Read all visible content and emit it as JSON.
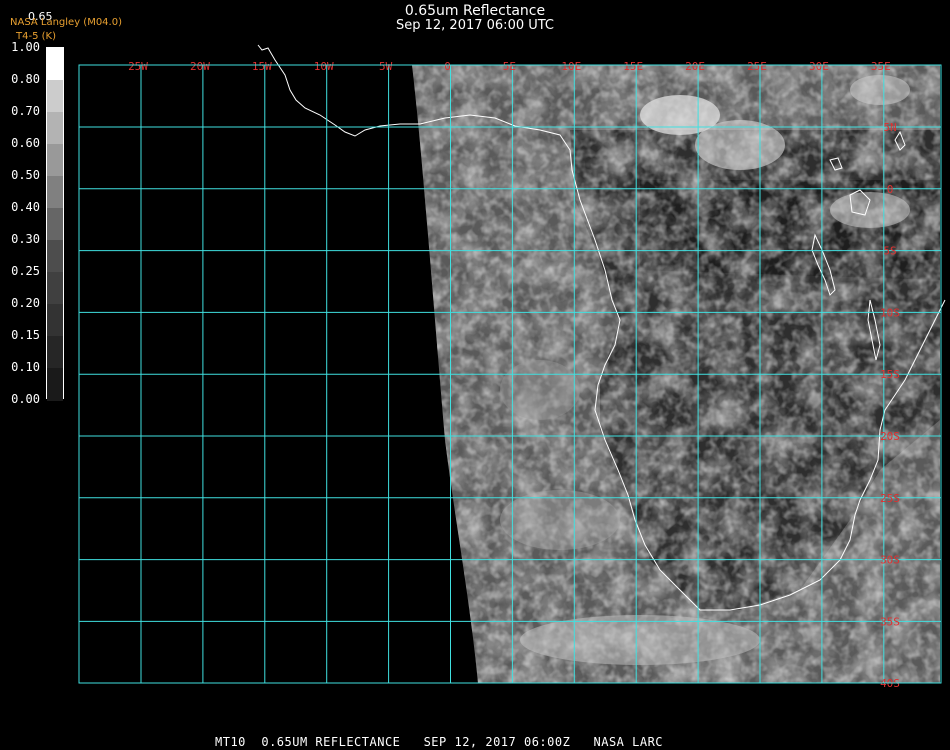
{
  "header": {
    "title": "0.65um Reflectance",
    "subtitle": "Sep 12, 2017 06:00 UTC",
    "credit": "NASA Langley (M04.0)",
    "credit_sub": "T4-5 (K)",
    "colorbar_top_label": "0.65"
  },
  "colorbar": {
    "ticks": [
      "1.00",
      "0.80",
      "0.70",
      "0.60",
      "0.50",
      "0.40",
      "0.30",
      "0.25",
      "0.20",
      "0.15",
      "0.10",
      "0.00"
    ],
    "values": [
      1.0,
      0.8,
      0.7,
      0.6,
      0.5,
      0.4,
      0.3,
      0.25,
      0.2,
      0.15,
      0.1,
      0.0
    ]
  },
  "map": {
    "lon_labels": [
      "25W",
      "20W",
      "15W",
      "10W",
      "5W",
      "0",
      "5E",
      "10E",
      "15E",
      "20E",
      "25E",
      "30E",
      "35E"
    ],
    "lat_labels": [
      "5N",
      "0",
      "5S",
      "10S",
      "15S",
      "20S",
      "25S",
      "30S",
      "35S",
      "40S"
    ],
    "grid_color": "#40e0e0",
    "label_color": "#e03030",
    "coast_color": "#ffffff"
  },
  "footer": {
    "text": "MT10  0.65UM REFLECTANCE   SEP 12, 2017 06:00Z   NASA LARC"
  }
}
